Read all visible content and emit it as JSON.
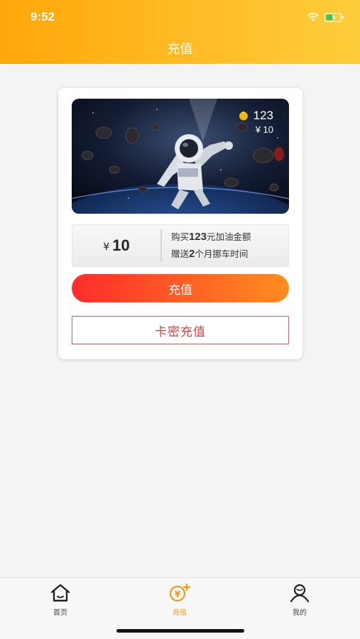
{
  "status_bar": {
    "time": "9:52"
  },
  "header": {
    "title": "充值"
  },
  "banner": {
    "coin_count": "123",
    "price": "¥ 10"
  },
  "package": {
    "currency": "¥",
    "amount": "10",
    "line1_prefix": "购买",
    "line1_value": "123",
    "line1_suffix": "元加油金额",
    "line2_prefix": "赠送",
    "line2_value": "2",
    "line2_suffix": "个月挪车时间"
  },
  "buttons": {
    "recharge": "充值",
    "card_key": "卡密充值"
  },
  "tabbar": {
    "items": [
      {
        "label": "首页",
        "icon": "home-icon"
      },
      {
        "label": "充值",
        "icon": "yuan-plus-icon",
        "active": true
      },
      {
        "label": "我的",
        "icon": "user-icon"
      }
    ]
  },
  "colors": {
    "accent": "#ffa70a",
    "primary_button": "#ff2c2c",
    "active_tab": "#f39a16"
  }
}
